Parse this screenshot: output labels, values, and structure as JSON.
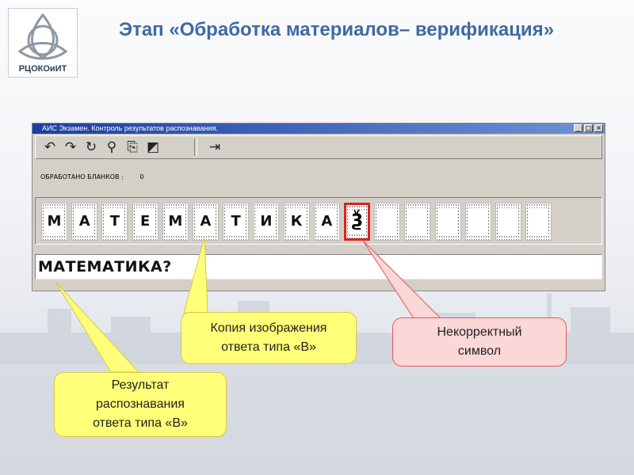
{
  "slide": {
    "title": "Этап «Обработка материалов– верификация»",
    "logo_text": "РЦОКОиИТ"
  },
  "window": {
    "title": "АИС Экзамен. Контроль результатов распознавания.",
    "buttons": [
      "_",
      "□",
      "×"
    ],
    "toolbar": [
      "undo-icon",
      "redo-icon",
      "refresh-icon",
      "search-icon",
      "copy-icon",
      "edit-icon",
      "exit-icon"
    ],
    "counter_label": "ОБРАБОТАНО БЛАНКОВ :",
    "counter_value": "0",
    "tiles": [
      {
        "char": "М",
        "state": "normal"
      },
      {
        "char": "А",
        "state": "normal"
      },
      {
        "char": "Т",
        "state": "normal"
      },
      {
        "char": "Е",
        "state": "normal"
      },
      {
        "char": "М",
        "state": "normal"
      },
      {
        "char": "А",
        "state": "normal"
      },
      {
        "char": "Т",
        "state": "normal"
      },
      {
        "char": "И",
        "state": "normal"
      },
      {
        "char": "К",
        "state": "normal"
      },
      {
        "char": "А",
        "state": "normal"
      },
      {
        "char": "Ѯ",
        "state": "incorrect"
      },
      {
        "char": "",
        "state": "empty"
      },
      {
        "char": "",
        "state": "empty"
      },
      {
        "char": "",
        "state": "empty"
      },
      {
        "char": "",
        "state": "empty"
      },
      {
        "char": "",
        "state": "empty"
      },
      {
        "char": "",
        "state": "empty"
      }
    ],
    "result_text": "МАТЕМАТИКА?"
  },
  "callouts": {
    "image_copy": "Копия изображения\nответа типа «В»",
    "incorrect": "Некорректный\nсимвол",
    "recognition": "Результат\nраспознавания\nответа типа «В»"
  },
  "colors": {
    "title": "#3f6aa3",
    "callout_yellow": "#ffff7a",
    "callout_pink": "#fbd7d7",
    "error_border": "#e02020"
  }
}
